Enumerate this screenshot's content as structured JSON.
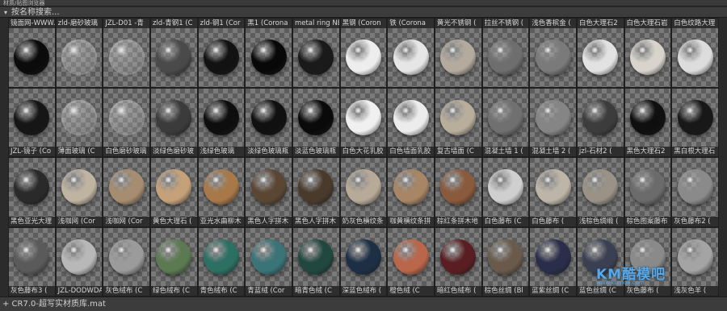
{
  "window": {
    "title": "材质/贴图浏览器"
  },
  "search": {
    "placeholder": "按名称搜索..."
  },
  "status": {
    "path": "+ CR7.0-超写实材质库.mat"
  },
  "watermark": {
    "brand": "KM酷模吧",
    "url": "www.kumo8.com"
  },
  "materials": [
    {
      "label": "镜面网-WWW.",
      "color": "#0b0b0b",
      "transparent": false
    },
    {
      "label": "zld-磨砂玻璃",
      "color": "#b4b4b4",
      "transparent": true
    },
    {
      "label": "JZL-D01 -青",
      "color": "#9aa3a6",
      "transparent": true
    },
    {
      "label": "zld-青钢1 (C",
      "color": "#4a4a4a",
      "transparent": false
    },
    {
      "label": "zld-钢1 (Cor",
      "color": "#121212",
      "transparent": false
    },
    {
      "label": "黑1 (Corona",
      "color": "#080808",
      "transparent": false
    },
    {
      "label": "metal ring NE",
      "color": "#1a1a1a",
      "transparent": false
    },
    {
      "label": "黑钢 (Coron",
      "color": "#ededed",
      "transparent": false
    },
    {
      "label": "铁 (Corona",
      "color": "#e6e6e6",
      "transparent": false
    },
    {
      "label": "黄光不锈钢 (",
      "color": "#b4ab9e",
      "transparent": false
    },
    {
      "label": "拉丝不锈钢 (",
      "color": "#6e6e6e",
      "transparent": false
    },
    {
      "label": "浅色香槟金 (",
      "color": "#7a7a7a",
      "transparent": false
    },
    {
      "label": "白色大理石2",
      "color": "#e2e2e2",
      "transparent": false
    },
    {
      "label": "白色大理石岩",
      "color": "#d8d4cc",
      "transparent": false
    },
    {
      "label": "白色纹路大理",
      "color": "#dcdcdc",
      "transparent": false
    },
    {
      "label": "JZL-镜子 (Co",
      "color": "#161616",
      "transparent": false
    },
    {
      "label": "薄面玻璃 (C",
      "color": "#cfcfcf",
      "transparent": true
    },
    {
      "label": "白色磨砂玻璃",
      "color": "#c0c0c0",
      "transparent": true
    },
    {
      "label": "淡绿色磨砂玻",
      "color": "#3b3b3b",
      "transparent": false
    },
    {
      "label": "浅绿色玻璃",
      "color": "#0e0e0e",
      "transparent": false
    },
    {
      "label": "淡绿色玻璃瓶",
      "color": "#101010",
      "transparent": false
    },
    {
      "label": "淡蓝色玻璃瓶",
      "color": "#0a0a0a",
      "transparent": false
    },
    {
      "label": "白色大花乳胶",
      "color": "#f0f0f0",
      "transparent": false
    },
    {
      "label": "白色墙面乳胶",
      "color": "#ececec",
      "transparent": false
    },
    {
      "label": "复古墙面 (C",
      "color": "#b9ae9c",
      "transparent": false
    },
    {
      "label": "混凝土墙 1 (",
      "color": "#707070",
      "transparent": false
    },
    {
      "label": "混凝土墙 2 (",
      "color": "#858585",
      "transparent": false
    },
    {
      "label": "jzl-石材2 (",
      "color": "#3c3c3c",
      "transparent": false
    },
    {
      "label": "黑色大理石2",
      "color": "#0f0f0f",
      "transparent": false
    },
    {
      "label": "黑白根大理石",
      "color": "#181818",
      "transparent": false
    },
    {
      "label": "黑色亚光大理",
      "color": "#2a2a2a",
      "transparent": false
    },
    {
      "label": "浅咖网 (Cor",
      "color": "#bfb3a1",
      "transparent": false
    },
    {
      "label": "浅咖网 (Cor",
      "color": "#a68d6f",
      "transparent": false
    },
    {
      "label": "黄色大理石 (",
      "color": "#c5a17a",
      "transparent": false
    },
    {
      "label": "亚光水曲柳木",
      "color": "#a87848",
      "transparent": false
    },
    {
      "label": "黑色人字拼木",
      "color": "#5b4634",
      "transparent": false
    },
    {
      "label": "黑色人字拼木",
      "color": "#4a3a2c",
      "transparent": false
    },
    {
      "label": "奶灰色横纹条",
      "color": "#b8aa98",
      "transparent": false
    },
    {
      "label": "咖黄横纹条拼",
      "color": "#a88564",
      "transparent": false
    },
    {
      "label": "棕红条拼木地",
      "color": "#8a5a3c",
      "transparent": false
    },
    {
      "label": "白色藤布 (C",
      "color": "#cfcfcf",
      "transparent": false
    },
    {
      "label": "白色藤布 (",
      "color": "#bdb6a8",
      "transparent": false
    },
    {
      "label": "浅棕色绸缎 (",
      "color": "#9a9286",
      "transparent": false
    },
    {
      "label": "棕色图案藤布",
      "color": "#6b6b6b",
      "transparent": false
    },
    {
      "label": "灰色藤布2 (",
      "color": "#8a8a8a",
      "transparent": false
    },
    {
      "label": "灰色藤布3 (",
      "color": "#5a5a5a",
      "transparent": false
    },
    {
      "label": "JZL-DODWDA",
      "color": "#b8b8b8",
      "transparent": false
    },
    {
      "label": "灰色绒布 (C",
      "color": "#9b9b9b",
      "transparent": false
    },
    {
      "label": "绿色绒布 (C",
      "color": "#5b7a52",
      "transparent": false
    },
    {
      "label": "青色绒布 (C",
      "color": "#2c6f63",
      "transparent": false
    },
    {
      "label": "青蓝绒 (Cor",
      "color": "#3a7478",
      "transparent": false
    },
    {
      "label": "暗青色绒 (C",
      "color": "#21483f",
      "transparent": false
    },
    {
      "label": "深蓝色绒布 (",
      "color": "#1d2f45",
      "transparent": false
    },
    {
      "label": "橙色绒 (C",
      "color": "#b9664a",
      "transparent": false
    },
    {
      "label": "暗红色绒布 (",
      "color": "#5a1e22",
      "transparent": false
    },
    {
      "label": "棕色丝绸 (Bl",
      "color": "#6a5a4c",
      "transparent": false
    },
    {
      "label": "蓝紫丝绸 (C",
      "color": "#2a2e4a",
      "transparent": false
    },
    {
      "label": "蓝色丝绸 (C",
      "color": "#3a3f52",
      "transparent": false
    },
    {
      "label": "灰色藤布 (",
      "color": "#8a8a8a",
      "transparent": false
    },
    {
      "label": "浅灰色羊 (",
      "color": "#a4a4a4",
      "transparent": false
    }
  ]
}
